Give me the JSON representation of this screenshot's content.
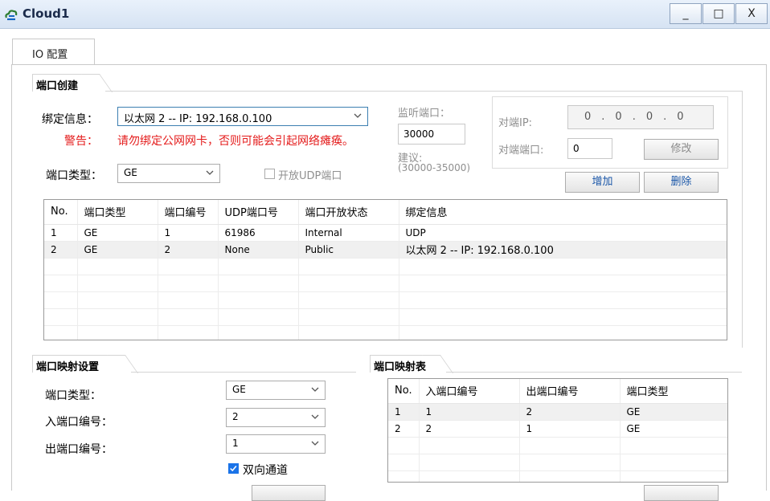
{
  "window": {
    "title": "Cloud1",
    "minimize": "_",
    "maximize": "□",
    "close": "X"
  },
  "main_tab": "IO 配置",
  "port_create": {
    "group_title": "端口创建",
    "bind_label": "绑定信息：",
    "bind_value": "以太网 2 -- IP: 192.168.0.100",
    "warning_label": "警告：",
    "warning_text": "请勿绑定公网网卡，否则可能会引起网络瘫痪。",
    "port_type_label": "端口类型：",
    "port_type_value": "GE",
    "udp_open_label": "开放UDP端口",
    "listen_port_label": "监听端口：",
    "listen_port_value": "30000",
    "suggest_label": "建议:",
    "suggest_range": "(30000-35000)",
    "peer_ip_label": "对端IP:",
    "peer_ip_octets": [
      "0",
      "0",
      "0",
      "0"
    ],
    "peer_port_label": "对端端口:",
    "peer_port_value": "0",
    "modify_button": "修改",
    "add_button": "增加",
    "delete_button": "删除",
    "table": {
      "headers": [
        "No.",
        "端口类型",
        "端口编号",
        "UDP端口号",
        "端口开放状态",
        "绑定信息"
      ],
      "rows": [
        [
          "1",
          "GE",
          "1",
          "61986",
          "Internal",
          "UDP"
        ],
        [
          "2",
          "GE",
          "2",
          "None",
          "Public",
          "以太网 2 -- IP: 192.168.0.100"
        ]
      ]
    }
  },
  "mapping_settings": {
    "group_title": "端口映射设置",
    "port_type_label": "端口类型：",
    "port_type_value": "GE",
    "in_port_label": "入端口编号：",
    "in_port_value": "2",
    "out_port_label": "出端口编号：",
    "out_port_value": "1",
    "bidirectional_label": "双向通道",
    "bidirectional_checked": true
  },
  "mapping_table": {
    "group_title": "端口映射表",
    "headers": [
      "No.",
      "入端口编号",
      "出端口编号",
      "端口类型"
    ],
    "rows": [
      [
        "1",
        "1",
        "2",
        "GE"
      ],
      [
        "2",
        "2",
        "1",
        "GE"
      ]
    ]
  },
  "colors": {
    "accent": "#1a73e8",
    "warning": "#e41b1b",
    "link_button_text": "#1b57a8"
  }
}
